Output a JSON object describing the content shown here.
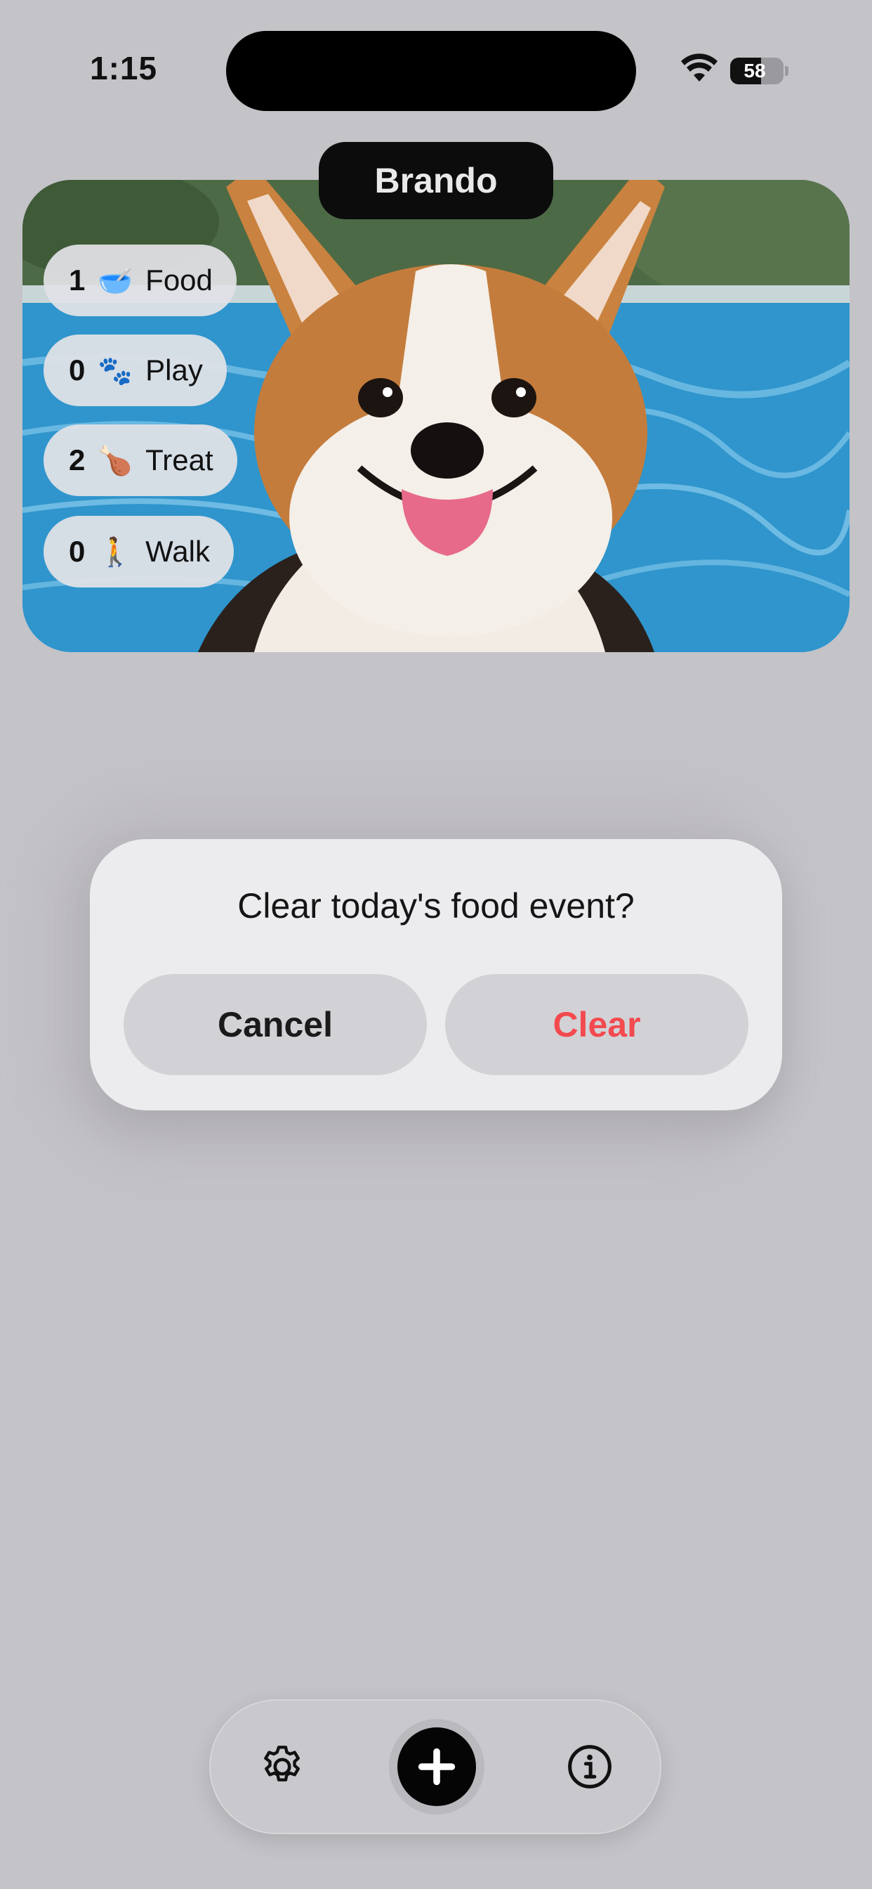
{
  "status_bar": {
    "time": "1:15",
    "battery_level": "58",
    "battery_fraction": 0.58
  },
  "pet": {
    "name": "Brando",
    "stats": [
      {
        "count": "1",
        "emoji": "🥣",
        "label": "Food"
      },
      {
        "count": "0",
        "emoji": "🐾",
        "label": "Play"
      },
      {
        "count": "2",
        "emoji": "🍗",
        "label": "Treat"
      },
      {
        "count": "0",
        "emoji": "🚶",
        "label": "Walk"
      }
    ]
  },
  "dialog": {
    "title": "Clear today's food event?",
    "cancel_label": "Cancel",
    "clear_label": "Clear",
    "clear_color": "#f24a4f"
  },
  "toolbar": {
    "icons": [
      "gear-icon",
      "plus-icon",
      "info-icon"
    ]
  }
}
